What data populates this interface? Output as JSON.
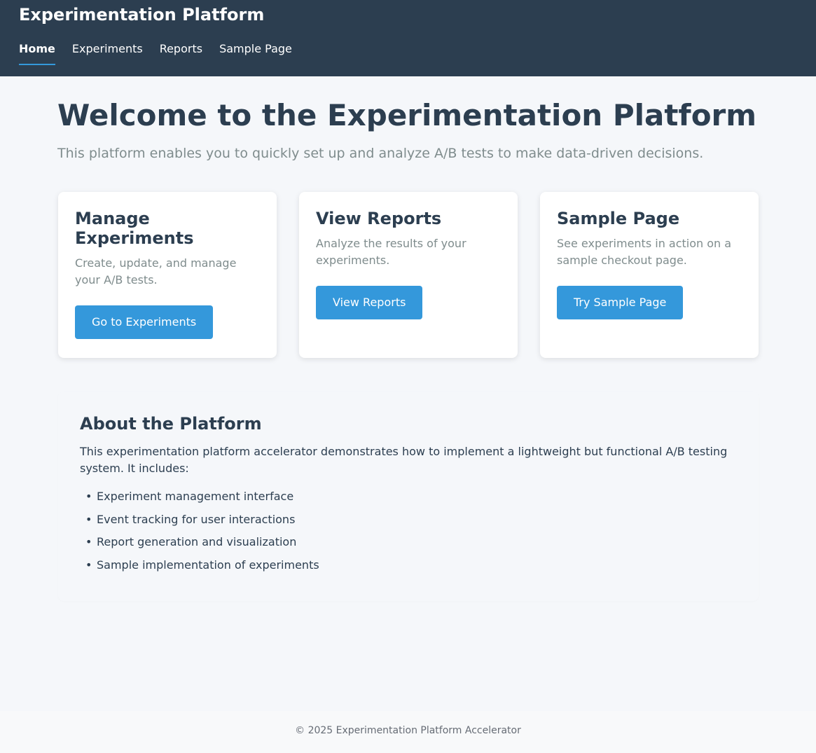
{
  "header": {
    "title": "Experimentation Platform",
    "nav": [
      {
        "label": "Home",
        "active": true
      },
      {
        "label": "Experiments",
        "active": false
      },
      {
        "label": "Reports",
        "active": false
      },
      {
        "label": "Sample Page",
        "active": false
      }
    ]
  },
  "hero": {
    "title": "Welcome to the Experimentation Platform",
    "subtitle": "This platform enables you to quickly set up and analyze A/B tests to make data-driven decisions."
  },
  "cards": [
    {
      "title": "Manage Experiments",
      "description": "Create, update, and manage your A/B tests.",
      "button": "Go to Experiments"
    },
    {
      "title": "View Reports",
      "description": "Analyze the results of your experiments.",
      "button": "View Reports"
    },
    {
      "title": "Sample Page",
      "description": "See experiments in action on a sample checkout page.",
      "button": "Try Sample Page"
    }
  ],
  "about": {
    "title": "About the Platform",
    "text": "This experimentation platform accelerator demonstrates how to implement a lightweight but functional A/B testing system. It includes:",
    "items": [
      "Experiment management interface",
      "Event tracking for user interactions",
      "Report generation and visualization",
      "Sample implementation of experiments"
    ]
  },
  "footer": {
    "text": "© 2025 Experimentation Platform Accelerator"
  },
  "colors": {
    "header_bg": "#2c3e50",
    "accent": "#3498db",
    "page_bg": "#f5f7fa"
  }
}
